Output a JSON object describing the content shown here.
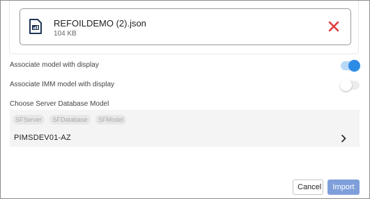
{
  "upload": {
    "file_name": "REFOILDEMO (2).json",
    "file_size": "104 KB",
    "file_icon": "json-file-icon",
    "remove_icon": "close-icon",
    "remove_color": "#e03c3c"
  },
  "options": {
    "associate_model": {
      "label": "Associate model with display",
      "enabled": true
    },
    "associate_imm": {
      "label": "Associate IMM model with display",
      "enabled": false
    }
  },
  "database": {
    "label": "Choose Server Database Model",
    "breadcrumb": [
      "SFServer",
      "SFDatabase",
      "SFModel"
    ],
    "item": "PIMSDEV01-AZ",
    "item_icon": "chevron-right-icon"
  },
  "actions": {
    "cancel_label": "Cancel",
    "import_label": "Import"
  },
  "colors": {
    "accent": "#2d8ce6",
    "import_button": "#7f9fda"
  }
}
